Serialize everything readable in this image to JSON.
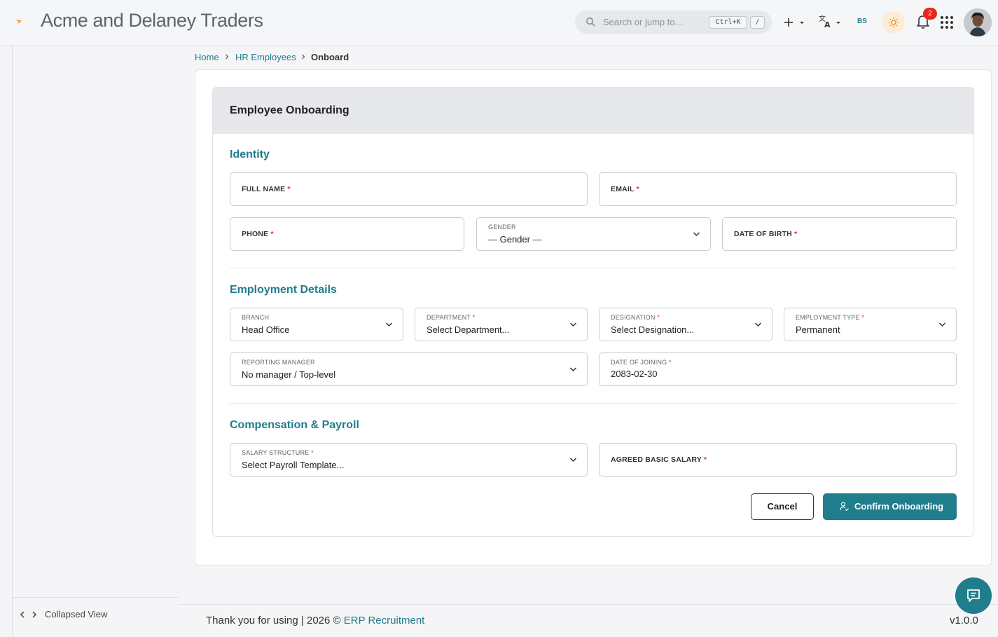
{
  "header": {
    "app_title": "Acme and Delaney Traders",
    "search_placeholder": "Search or jump to...",
    "shortcut_primary": "Ctrl+K",
    "shortcut_secondary": "/",
    "language_code": "BS",
    "notification_count": "2"
  },
  "sidebar": {
    "collapse_label": "Collapsed View"
  },
  "breadcrumb": {
    "home": "Home",
    "section": "HR Employees",
    "current": "Onboard"
  },
  "form": {
    "title": "Employee Onboarding",
    "identity": {
      "title": "Identity",
      "full_name_label": "FULL NAME",
      "email_label": "EMAIL",
      "phone_label": "PHONE",
      "gender_label": "GENDER",
      "gender_value": "— Gender —",
      "dob_label": "DATE OF BIRTH"
    },
    "employment": {
      "title": "Employment Details",
      "branch_label": "BRANCH",
      "branch_value": "Head Office",
      "department_label": "DEPARTMENT",
      "department_value": "Select Department...",
      "designation_label": "DESIGNATION",
      "designation_value": "Select Designation...",
      "type_label": "EMPLOYMENT TYPE",
      "type_value": "Permanent",
      "manager_label": "REPORTING MANAGER",
      "manager_value": "No manager / Top-level",
      "joining_label": "DATE OF JOINING",
      "joining_value": "2083-02-30"
    },
    "compensation": {
      "title": "Compensation & Payroll",
      "structure_label": "SALARY STRUCTURE",
      "structure_value": "Select Payroll Template...",
      "salary_label": "AGREED BASIC SALARY"
    },
    "required_mark": "*",
    "cancel_label": "Cancel",
    "confirm_label": "Confirm Onboarding"
  },
  "footer": {
    "text": "Thank you for using | 2026 ©",
    "link": "ERP Recruitment",
    "version": "v1.0.0"
  },
  "colors": {
    "accent": "#1f7d8c",
    "required": "#d9342b",
    "badge": "#e8271c"
  }
}
